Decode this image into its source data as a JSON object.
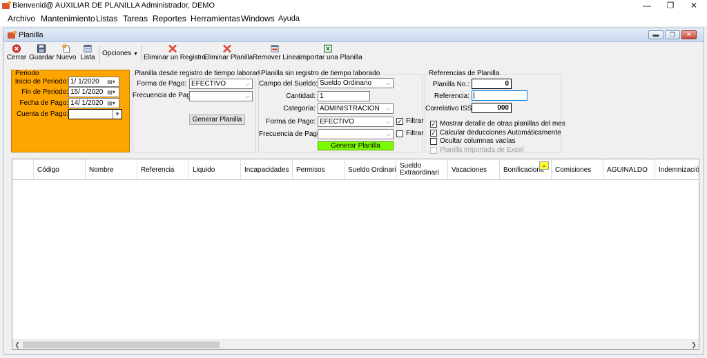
{
  "window": {
    "title": "Bienvenid@ AUXILIAR DE PLANILLA Administrador, DEMO",
    "min": "—",
    "max": "❐",
    "close": "✕"
  },
  "menu": [
    "Archivo",
    "Mantenimiento",
    "Listas",
    "Tareas",
    "Reportes",
    "Herramientas",
    "Windows",
    "Ayuda"
  ],
  "child": {
    "title": "Planilla"
  },
  "toolbar": {
    "cerrar": "Cerrar",
    "guardar": "Guardar",
    "nuevo": "Nuevo",
    "lista": "Lista",
    "opciones": "Opciones",
    "eliminar_registro": "Eliminar un Registro",
    "eliminar_planilla": "Eliminar Planilla",
    "remover_linea": "Remover Línea",
    "importar": "Importar una Planilla"
  },
  "periodo": {
    "title": "Periodo",
    "inicio_label": "Inicio de Periodo:",
    "inicio_value": "1/ 1/2020",
    "fin_label": "Fin de Periodo:",
    "fin_value": "15/ 1/2020",
    "fecha_label": "Fecha de Pago:",
    "fecha_value": "14/ 1/2020",
    "cuenta_label": "Cuenta de Pago:",
    "cuenta_value": ""
  },
  "desde_registro": {
    "title": "Planilla desde registro de tiempo laborado",
    "forma_label": "Forma de Pago:",
    "forma_value": "EFECTIVO",
    "frecuencia_label": "Frecuencia de Pago:",
    "frecuencia_value": "",
    "generar": "Generar Planilla"
  },
  "sin_registro": {
    "title": "Planilla sin registro de tiempo laborado",
    "campo_label": "Campo del Sueldo:",
    "campo_value": "Sueldo Ordinario",
    "cantidad_label": "Cantidad:",
    "cantidad_value": "1",
    "categoria_label": "Categoría:",
    "categoria_value": "ADMINISTRACION",
    "forma_label": "Forma de Pago:",
    "forma_value": "EFECTIVO",
    "frecuencia_label": "Frecuencia de Pago:",
    "frecuencia_value": "",
    "filtrar1": "Filtrar",
    "filtrar2": "Filtrar",
    "generar": "Generar Planilla"
  },
  "referencias": {
    "title": "Referencias de Planilla",
    "planilla_no_label": "Planilla No.:",
    "planilla_no_value": "0",
    "referencia_label": "Referencia:",
    "referencia_value": "",
    "correlativo_label": "Correlativo ISSS:",
    "correlativo_value": "000",
    "opt1": "Mostrar detalle de otras planillas del mes",
    "opt2": "Calcular deducciones Automáticamente",
    "opt3": "Ocultar columnas vacías",
    "opt4": "Planilla Importada de Excel"
  },
  "grid": {
    "columns": [
      "Código",
      "Nombre",
      "Referencia",
      "Liquido",
      "Incapacidades",
      "Permisos",
      "Sueldo Ordinario",
      "Sueldo Extraordinari",
      "Vacaciones",
      "Bonificacione",
      "Comisiones",
      "AGUINALDO",
      "Indemnización"
    ]
  },
  "colors": {
    "periodo_bg": "#ffa500",
    "generar_bg": "#7cfc00"
  }
}
